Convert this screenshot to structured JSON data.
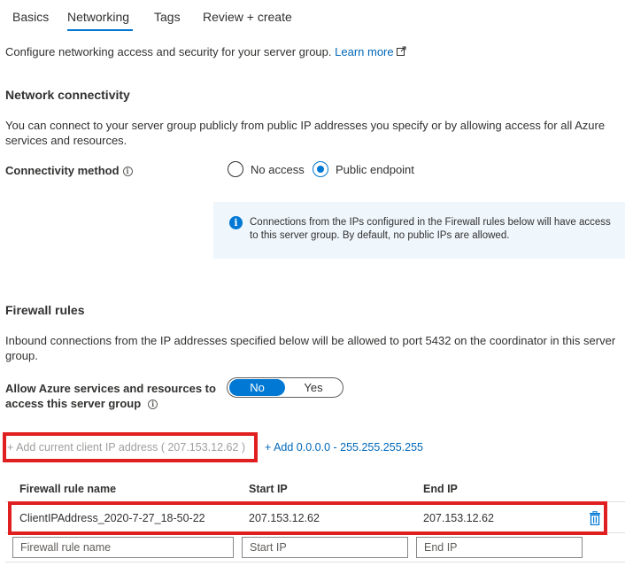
{
  "tabs": [
    {
      "label": "Basics"
    },
    {
      "label": "Networking"
    },
    {
      "label": "Tags"
    },
    {
      "label": "Review + create"
    }
  ],
  "intro": {
    "text": "Configure networking access and security for your server group.",
    "learn_more": "Learn more"
  },
  "network": {
    "title": "Network connectivity",
    "description": "You can connect to your server group publicly from public IP addresses you specify or by allowing access for all Azure services and resources.",
    "connectivity_label": "Connectivity method",
    "options": [
      {
        "label": "No access",
        "selected": false
      },
      {
        "label": "Public endpoint",
        "selected": true
      }
    ],
    "info": "Connections from the IPs configured in the Firewall rules below will have access to this server group. By default, no public IPs are allowed."
  },
  "firewall": {
    "title": "Firewall rules",
    "description": "Inbound connections from the IP addresses specified below will be allowed to port 5432 on the coordinator in this server group.",
    "allow_label": "Allow Azure services and resources to access this server group",
    "toggle": {
      "no": "No",
      "yes": "Yes",
      "value": "No"
    },
    "add_client_ip": "+ Add current client IP address ( 207.153.12.62 )",
    "add_range": "+ Add 0.0.0.0 - 255.255.255.255",
    "columns": [
      "Firewall rule name",
      "Start IP",
      "End IP"
    ],
    "rows": [
      {
        "name": "ClientIPAddress_2020-7-27_18-50-22",
        "start": "207.153.12.62",
        "end": "207.153.12.62"
      }
    ],
    "new_row": {
      "name_placeholder": "Firewall rule name",
      "start_placeholder": "Start IP",
      "end_placeholder": "End IP"
    }
  },
  "colors": {
    "accent": "#0078d4",
    "highlight": "#e02020",
    "info_bg": "#eff6fc"
  }
}
